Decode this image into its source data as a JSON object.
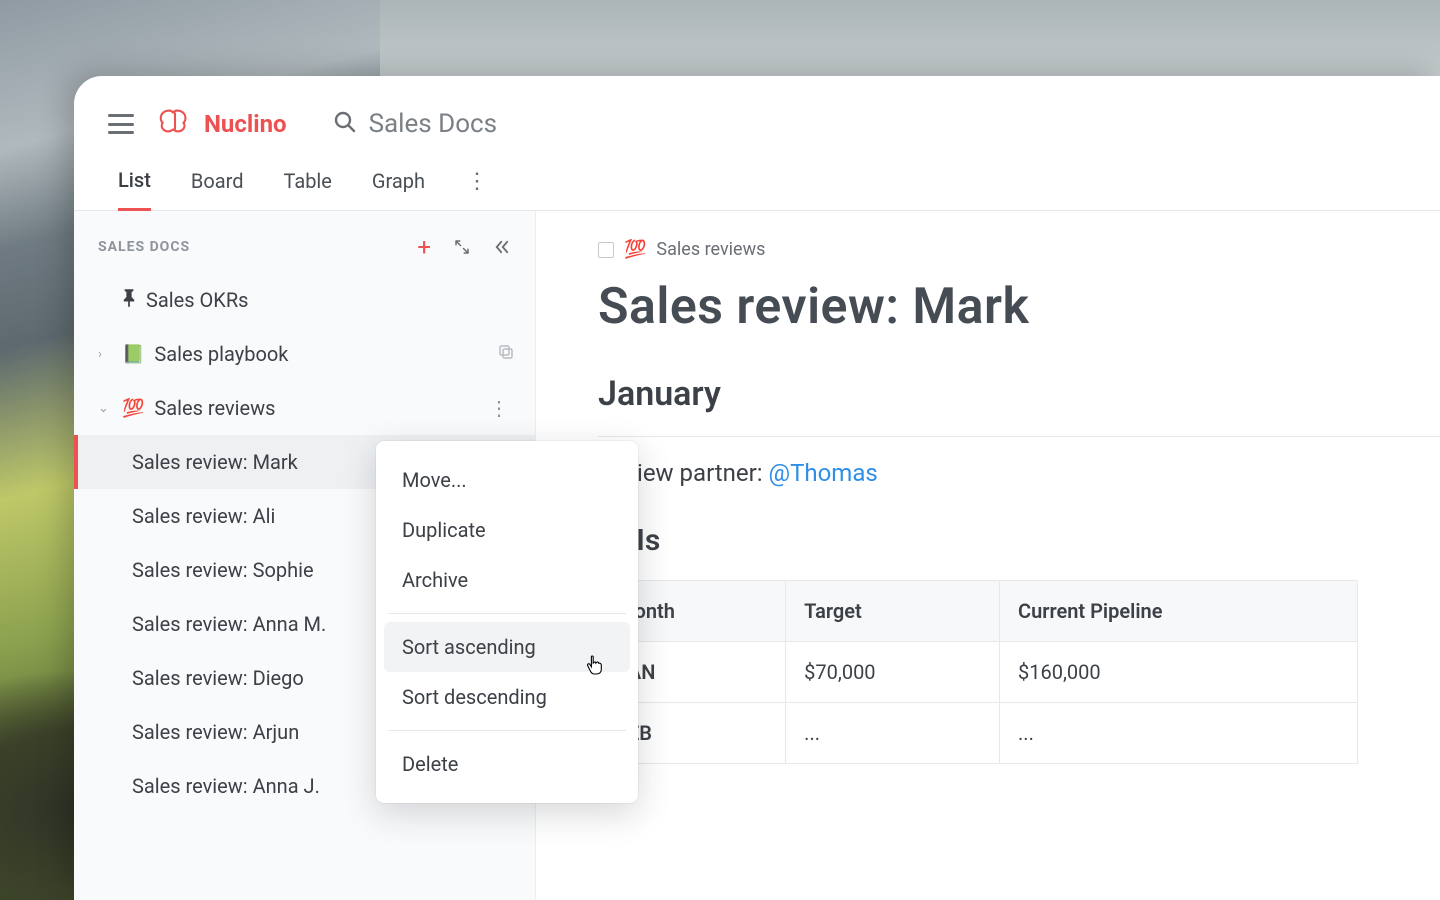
{
  "brand": {
    "name": "Nuclino"
  },
  "search": {
    "text": "Sales Docs"
  },
  "viewtabs": {
    "list": "List",
    "board": "Board",
    "table": "Table",
    "graph": "Graph"
  },
  "sidebar": {
    "title": "SALES DOCS",
    "items": {
      "okrs": {
        "label": "Sales OKRs"
      },
      "playbook": {
        "label": "Sales playbook",
        "emoji": "📗"
      },
      "reviews": {
        "label": "Sales reviews",
        "emoji": "💯"
      }
    },
    "children": [
      {
        "label": "Sales review: Mark"
      },
      {
        "label": "Sales review: Ali"
      },
      {
        "label": "Sales review: Sophie"
      },
      {
        "label": "Sales review: Anna M."
      },
      {
        "label": "Sales review: Diego"
      },
      {
        "label": "Sales review: Arjun"
      },
      {
        "label": "Sales review: Anna J."
      }
    ]
  },
  "context_menu": {
    "move": "Move...",
    "duplicate": "Duplicate",
    "archive": "Archive",
    "sort_asc": "Sort ascending",
    "sort_desc": "Sort descending",
    "delete": "Delete"
  },
  "breadcrumb": {
    "emoji": "💯",
    "label": "Sales reviews"
  },
  "page": {
    "title": "Sales review: Mark",
    "section1": "January",
    "review_partner_label": "Review partner: ",
    "review_partner_mention": "@Thomas",
    "section2": "KPIs"
  },
  "kpi_table": {
    "headers": {
      "month": "Month",
      "target": "Target",
      "pipeline": "Current Pipeline"
    },
    "rows": [
      {
        "month": "JAN",
        "target": "$70,000",
        "pipeline": "$160,000"
      },
      {
        "month": "FEB",
        "target": "...",
        "pipeline": "..."
      }
    ]
  }
}
